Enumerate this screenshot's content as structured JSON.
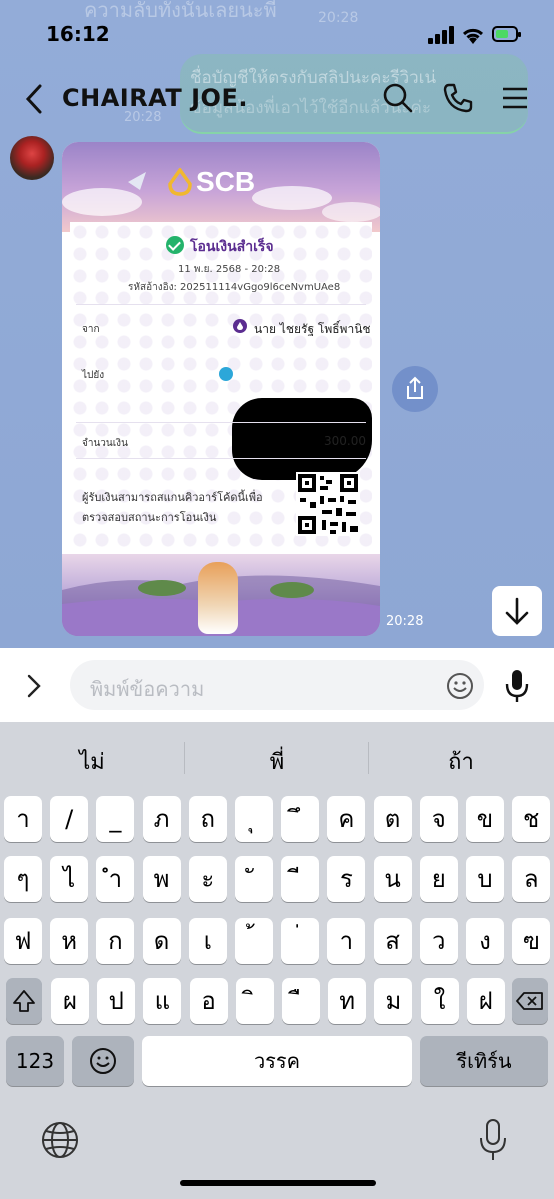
{
  "status_bar": {
    "time": "16:12"
  },
  "ghost_text": {
    "top": "ความลับทั้งนั้นเลยนะพี่",
    "bubble_line1": "ชื่อบัญชีให้ตรงกับสลิปนะคะรีวิวเน่",
    "bubble_line2": "ข้อมูลน้องพี่เอาไว้ใช้อีกแล้วนะค่ะ",
    "time1": "20:28",
    "time2": "20:28"
  },
  "header": {
    "title": "CHAIRAT JOE."
  },
  "slip": {
    "brand": "SCB",
    "status": "โอนเงินสำเร็จ",
    "date": "11 พ.ย. 2568 - 20:28",
    "ref_label": "รหัสอ้างอิง:",
    "ref": "202511114vGgo9l6ceNvmUAe8",
    "from_label": "จาก",
    "from_name": "นาย ไชยรัฐ โพธิ์พานิช",
    "to_label": "ไปยัง",
    "amount_label": "จำนวนเงิน",
    "amount": "300.00",
    "qr_note_1": "ผู้รับเงินสามารถสแกนคิวอาร์โค้ดนี้เพื่อ",
    "qr_note_2": "ตรวจสอบสถานะการโอนเงิน"
  },
  "message_time": "20:28",
  "input": {
    "placeholder": "พิมพ์ข้อความ"
  },
  "suggestions": [
    "ไม่",
    "พี่",
    "ถ้า"
  ],
  "keyboard": {
    "row1": [
      "า",
      "/",
      "_",
      "ภ",
      "ถ",
      "ุ",
      "ึ",
      "ค",
      "ต",
      "จ",
      "ข",
      "ช"
    ],
    "row2": [
      "ๆ",
      "ไ",
      "ำ",
      "พ",
      "ะ",
      "ั",
      "ี",
      "ร",
      "น",
      "ย",
      "บ",
      "ล"
    ],
    "row3": [
      "ฟ",
      "ห",
      "ก",
      "ด",
      "เ",
      "้",
      "่",
      "า",
      "ส",
      "ว",
      "ง",
      "ฃ"
    ],
    "row4": [
      "ผ",
      "ป",
      "แ",
      "อ",
      "ิ",
      "ื",
      "ท",
      "ม",
      "ใ",
      "ฝ"
    ],
    "numbers_key": "123",
    "space_key": "วรรค",
    "return_key": "รีเทิร์น"
  },
  "colors": {
    "chat_bg": "#8fa9d6",
    "slip_purple": "#5b2d90",
    "success_green": "#24b36b"
  }
}
